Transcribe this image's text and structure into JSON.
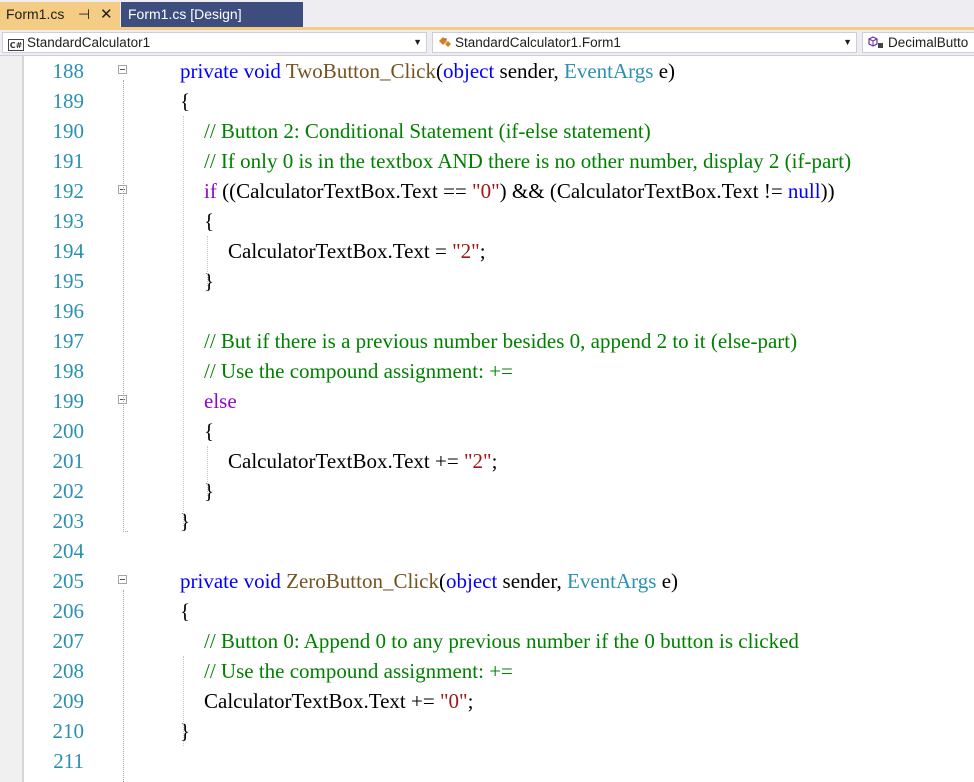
{
  "tabs": [
    {
      "label": "Form1.cs",
      "active": true
    },
    {
      "label": "Form1.cs [Design]",
      "active": false
    }
  ],
  "navbar": {
    "project": "StandardCalculator1",
    "class": "StandardCalculator1.Form1",
    "member": "DecimalButto"
  },
  "colors": {
    "keyword": "#0000ff",
    "type": "#2b91af",
    "comment": "#008000",
    "string": "#a31515",
    "method": "#74531f",
    "control": "#8f08c4",
    "line_number": "#2b91af",
    "active_tab": "#f5cc84",
    "inactive_tab": "#3d4e7e"
  },
  "code_lines": [
    {
      "n": "188",
      "indent": 0,
      "fold": true,
      "tokens": [
        [
          "kw",
          "private"
        ],
        [
          "",
          " "
        ],
        [
          "kw",
          "void"
        ],
        [
          "",
          " "
        ],
        [
          "mt",
          "TwoButton_Click"
        ],
        [
          "",
          "("
        ],
        [
          "kw",
          "object"
        ],
        [
          "",
          " sender, "
        ],
        [
          "ty",
          "EventArgs"
        ],
        [
          "",
          " e)"
        ]
      ]
    },
    {
      "n": "189",
      "indent": 0,
      "tokens": [
        [
          "",
          "{"
        ]
      ]
    },
    {
      "n": "190",
      "indent": 1,
      "tokens": [
        [
          "cm",
          "// Button 2: Conditional Statement (if-else statement)"
        ]
      ]
    },
    {
      "n": "191",
      "indent": 1,
      "tokens": [
        [
          "cm",
          "// If only 0 is in the textbox AND there is no other number, display 2 (if-part)"
        ]
      ]
    },
    {
      "n": "192",
      "indent": 1,
      "fold": true,
      "tokens": [
        [
          "ctl",
          "if"
        ],
        [
          "",
          " ((CalculatorTextBox.Text == "
        ],
        [
          "st",
          "\"0\""
        ],
        [
          "",
          ") && (CalculatorTextBox.Text != "
        ],
        [
          "kw",
          "null"
        ],
        [
          "",
          "))"
        ]
      ]
    },
    {
      "n": "193",
      "indent": 1,
      "tokens": [
        [
          "",
          "{"
        ]
      ]
    },
    {
      "n": "194",
      "indent": 2,
      "tokens": [
        [
          "",
          "CalculatorTextBox.Text = "
        ],
        [
          "st",
          "\"2\""
        ],
        [
          "",
          ";"
        ]
      ]
    },
    {
      "n": "195",
      "indent": 1,
      "tokens": [
        [
          "",
          "}"
        ]
      ]
    },
    {
      "n": "196",
      "indent": 0,
      "tokens": []
    },
    {
      "n": "197",
      "indent": 1,
      "tokens": [
        [
          "cm",
          "// But if there is a previous number besides 0, append 2 to it (else-part)"
        ]
      ]
    },
    {
      "n": "198",
      "indent": 1,
      "tokens": [
        [
          "cm",
          "// Use the compound assignment: +="
        ]
      ]
    },
    {
      "n": "199",
      "indent": 1,
      "fold": true,
      "tokens": [
        [
          "ctl",
          "else"
        ]
      ]
    },
    {
      "n": "200",
      "indent": 1,
      "tokens": [
        [
          "",
          "{"
        ]
      ]
    },
    {
      "n": "201",
      "indent": 2,
      "tokens": [
        [
          "",
          "CalculatorTextBox.Text += "
        ],
        [
          "st",
          "\"2\""
        ],
        [
          "",
          ";"
        ]
      ]
    },
    {
      "n": "202",
      "indent": 1,
      "tokens": [
        [
          "",
          "}"
        ]
      ]
    },
    {
      "n": "203",
      "indent": 0,
      "tokens": [
        [
          "",
          "}"
        ]
      ]
    },
    {
      "n": "204",
      "indent": 0,
      "tokens": []
    },
    {
      "n": "205",
      "indent": 0,
      "fold": true,
      "tokens": [
        [
          "kw",
          "private"
        ],
        [
          "",
          " "
        ],
        [
          "kw",
          "void"
        ],
        [
          "",
          " "
        ],
        [
          "mt",
          "ZeroButton_Click"
        ],
        [
          "",
          "("
        ],
        [
          "kw",
          "object"
        ],
        [
          "",
          " sender, "
        ],
        [
          "ty",
          "EventArgs"
        ],
        [
          "",
          " e)"
        ]
      ]
    },
    {
      "n": "206",
      "indent": 0,
      "tokens": [
        [
          "",
          "{"
        ]
      ]
    },
    {
      "n": "207",
      "indent": 1,
      "tokens": [
        [
          "cm",
          "// Button 0: Append 0 to any previous number if the 0 button is clicked"
        ]
      ]
    },
    {
      "n": "208",
      "indent": 1,
      "tokens": [
        [
          "cm",
          "// Use the compound assignment: +="
        ]
      ]
    },
    {
      "n": "209",
      "indent": 1,
      "tokens": [
        [
          "",
          "CalculatorTextBox.Text += "
        ],
        [
          "st",
          "\"0\""
        ],
        [
          "",
          ";"
        ]
      ]
    },
    {
      "n": "210",
      "indent": 0,
      "tokens": [
        [
          "",
          "}"
        ]
      ]
    },
    {
      "n": "211",
      "indent": 0,
      "tokens": []
    }
  ]
}
